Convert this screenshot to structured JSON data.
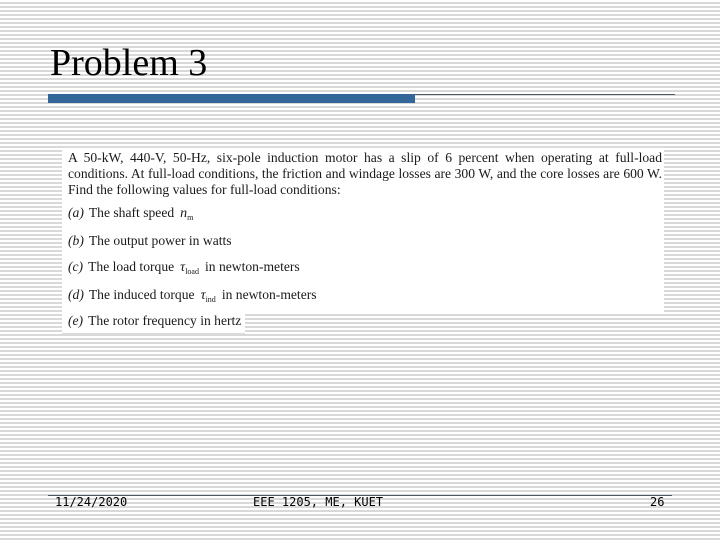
{
  "slide": {
    "title": "Problem 3",
    "accent_color": "#336699"
  },
  "problem": {
    "statement": "A 50-kW, 440-V, 50-Hz, six-pole induction motor has a slip of 6 percent when operating at full-load conditions.  At full-load conditions, the friction and windage losses are 300 W, and the core losses are 600 W.  Find the following values for full-load conditions:",
    "parts": [
      {
        "label": "(a)",
        "text_before": "The shaft speed",
        "symbol": "n",
        "subscript": "m",
        "text_after": ""
      },
      {
        "label": "(b)",
        "text_before": "The output power in watts",
        "symbol": "",
        "subscript": "",
        "text_after": ""
      },
      {
        "label": "(c)",
        "text_before": "The load torque",
        "symbol": "τ",
        "subscript": "load",
        "text_after": "in newton-meters"
      },
      {
        "label": "(d)",
        "text_before": "The induced torque",
        "symbol": "τ",
        "subscript": "ind",
        "text_after": "in newton-meters"
      },
      {
        "label": "(e)",
        "text_before": "The rotor frequency in hertz",
        "symbol": "",
        "subscript": "",
        "text_after": ""
      }
    ]
  },
  "footer": {
    "date": "11/24/2020",
    "course": "EEE 1205, ME, KUET",
    "page_number": "26"
  }
}
